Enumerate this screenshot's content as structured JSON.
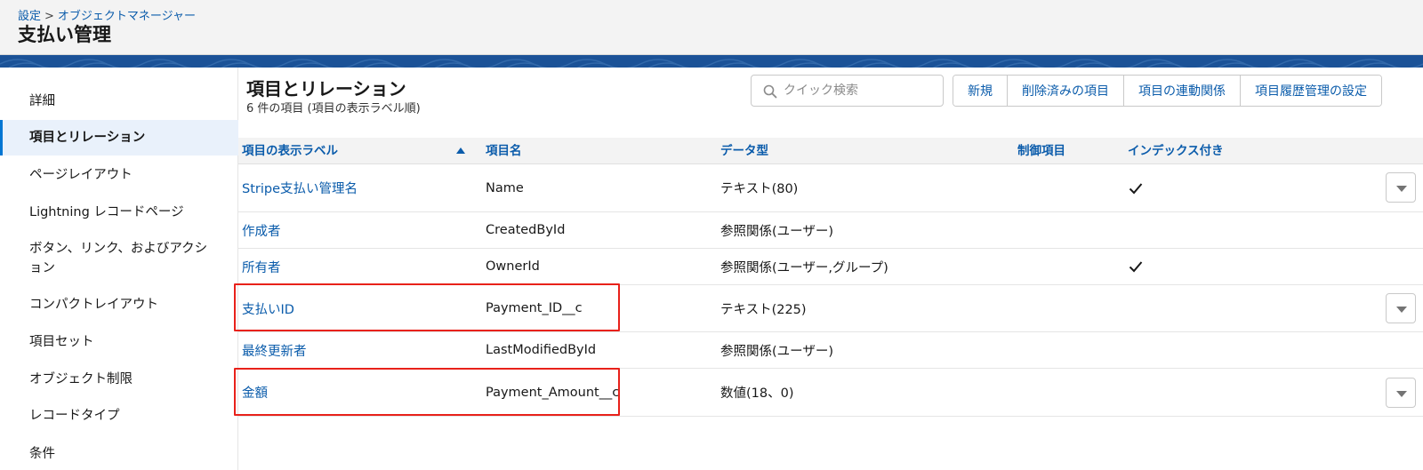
{
  "header": {
    "breadcrumb": {
      "root": "設定",
      "separator": ">",
      "current": "オブジェクトマネージャー"
    },
    "title": "支払い管理"
  },
  "sidebar": {
    "items": [
      {
        "label": "詳細"
      },
      {
        "label": "項目とリレーション",
        "active": true
      },
      {
        "label": "ページレイアウト"
      },
      {
        "label": "Lightning レコードページ"
      },
      {
        "label": "ボタン、リンク、およびアクション"
      },
      {
        "label": "コンパクトレイアウト"
      },
      {
        "label": "項目セット"
      },
      {
        "label": "オブジェクト制限"
      },
      {
        "label": "レコードタイプ"
      },
      {
        "label": "条件"
      }
    ]
  },
  "main": {
    "title": "項目とリレーション",
    "subtitle": "6 件の項目 (項目の表示ラベル順)",
    "search": {
      "placeholder": "クイック検索"
    },
    "buttons": {
      "new": "新規",
      "deleted": "削除済みの項目",
      "dependencies": "項目の連動関係",
      "history": "項目履歴管理の設定"
    },
    "table": {
      "headers": {
        "label": "項目の表示ラベル",
        "api_name": "項目名",
        "type": "データ型",
        "controlling": "制御項目",
        "indexed": "インデックス付き"
      },
      "sort": {
        "column": "label",
        "direction": "ascending"
      },
      "rows": [
        {
          "label": "Stripe支払い管理名",
          "api_name": "Name",
          "type": "テキスト(80)",
          "controlling": "",
          "indexed": true,
          "has_action": true,
          "highlighted": false
        },
        {
          "label": "作成者",
          "api_name": "CreatedById",
          "type": "参照関係(ユーザー)",
          "controlling": "",
          "indexed": false,
          "has_action": false,
          "highlighted": false
        },
        {
          "label": "所有者",
          "api_name": "OwnerId",
          "type": "参照関係(ユーザー,グループ)",
          "controlling": "",
          "indexed": true,
          "has_action": false,
          "highlighted": false
        },
        {
          "label": "支払いID",
          "api_name": "Payment_ID__c",
          "type": "テキスト(225)",
          "controlling": "",
          "indexed": false,
          "has_action": true,
          "highlighted": true
        },
        {
          "label": "最終更新者",
          "api_name": "LastModifiedById",
          "type": "参照関係(ユーザー)",
          "controlling": "",
          "indexed": false,
          "has_action": false,
          "highlighted": false
        },
        {
          "label": "金額",
          "api_name": "Payment_Amount__c",
          "type": "数値(18、0)",
          "controlling": "",
          "indexed": false,
          "has_action": true,
          "highlighted": true
        }
      ]
    }
  },
  "colors": {
    "link": "#0b5cab",
    "brand_band": "#1b5297",
    "highlight": "#e8211a",
    "active_bg": "#e9f1fb",
    "active_bar": "#0176d3"
  },
  "icons": {
    "search": "search-icon",
    "check": "check-icon",
    "row_menu": "chevron-down-icon",
    "sort": "sort-ascending-icon"
  }
}
